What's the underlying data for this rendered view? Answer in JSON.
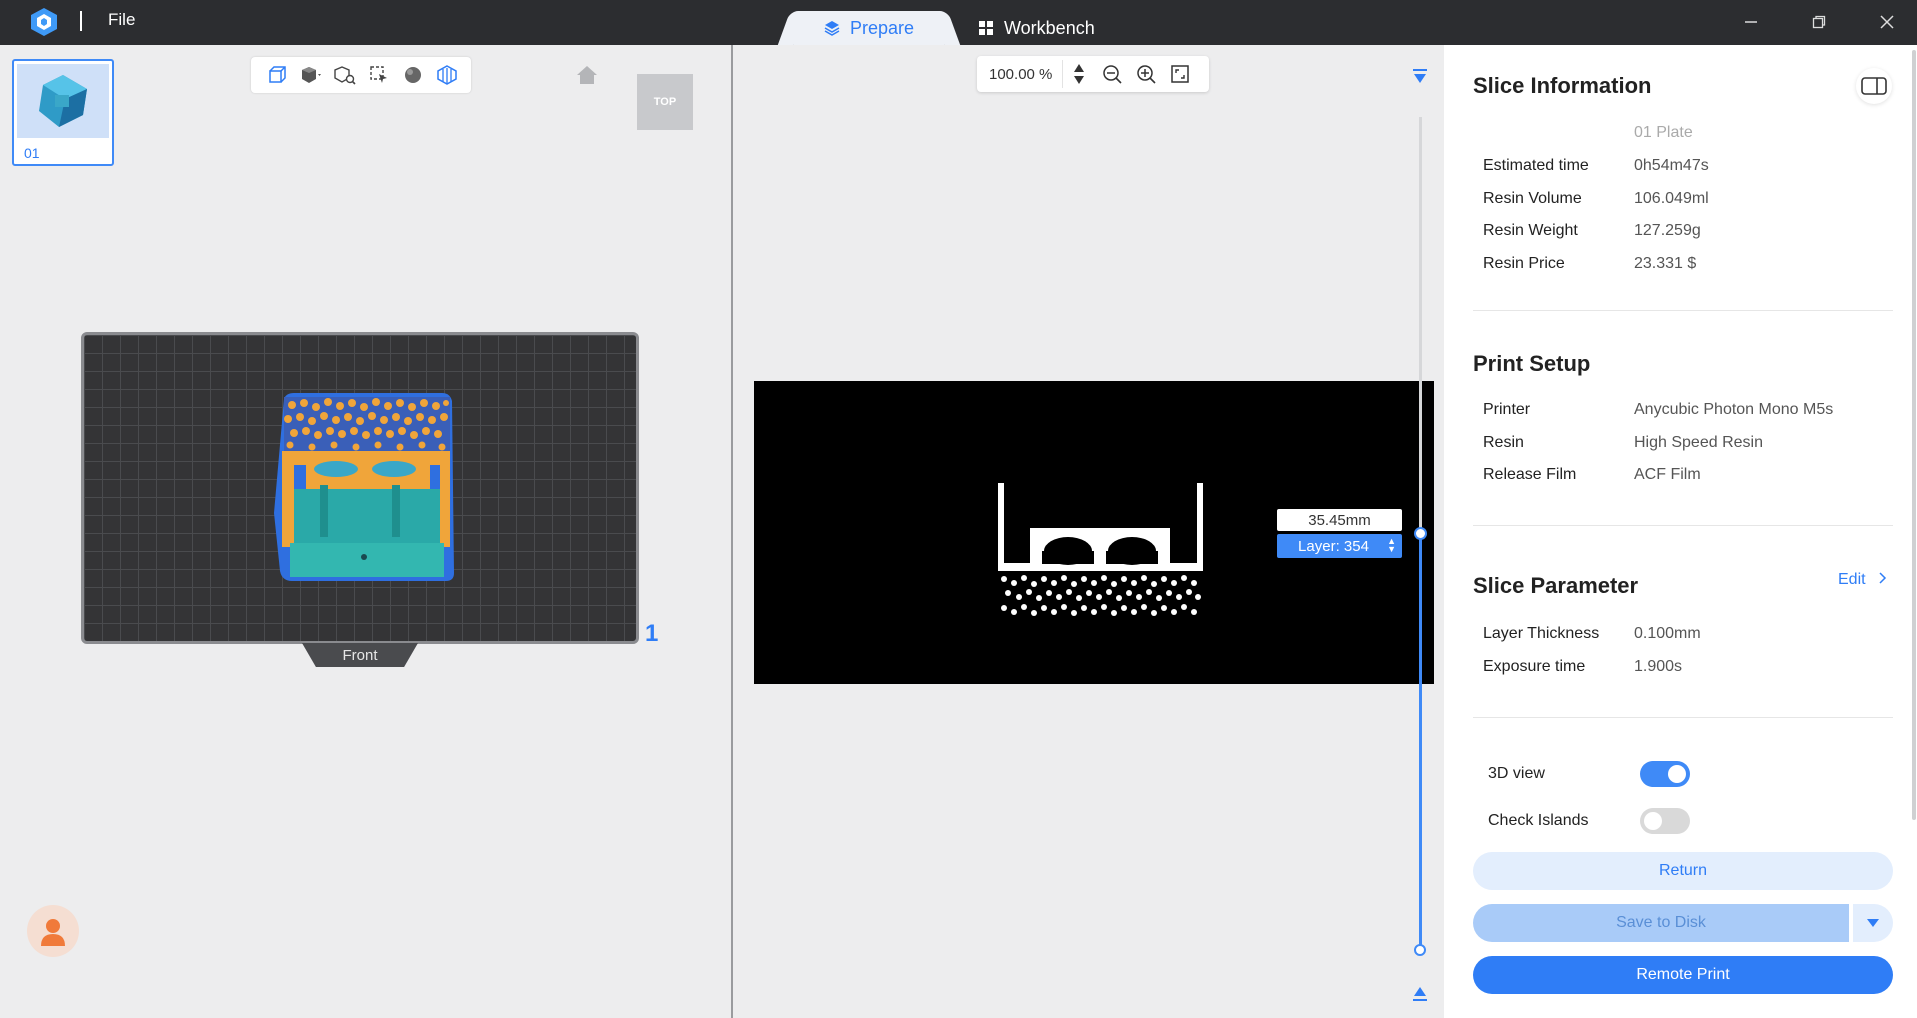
{
  "titlebar": {
    "file_menu": "File",
    "tabs": [
      {
        "label": "Prepare",
        "active": true
      },
      {
        "label": "Workbench",
        "active": false
      }
    ]
  },
  "left_panel": {
    "plate_label": "01",
    "view_cube_label": "TOP",
    "front_label": "Front",
    "plate_number": "1"
  },
  "preview": {
    "zoom_value": "100.00 %",
    "layer_height": "35.45mm",
    "layer_label": "Layer: 354"
  },
  "slice_info": {
    "title": "Slice Information",
    "plate_name": "01 Plate",
    "rows": [
      {
        "label": "Estimated time",
        "value": "0h54m47s"
      },
      {
        "label": "Resin Volume",
        "value": "106.049ml"
      },
      {
        "label": "Resin Weight",
        "value": "127.259g"
      },
      {
        "label": "Resin Price",
        "value": "23.331 $"
      }
    ]
  },
  "print_setup": {
    "title": "Print Setup",
    "rows": [
      {
        "label": "Printer",
        "value": "Anycubic Photon Mono M5s"
      },
      {
        "label": "Resin",
        "value": "High Speed Resin"
      },
      {
        "label": "Release Film",
        "value": "ACF Film"
      }
    ]
  },
  "slice_parameter": {
    "title": "Slice Parameter",
    "edit_label": "Edit",
    "rows": [
      {
        "label": "Layer Thickness",
        "value": "0.100mm"
      },
      {
        "label": "Exposure time",
        "value": "1.900s"
      }
    ]
  },
  "toggles": {
    "view3d_label": "3D view",
    "view3d_on": true,
    "islands_label": "Check Islands",
    "islands_on": false
  },
  "buttons": {
    "return": "Return",
    "save": "Save to Disk",
    "remote": "Remote Print"
  },
  "colors": {
    "accent": "#2f7df6",
    "titlebar": "#2c2d30"
  }
}
